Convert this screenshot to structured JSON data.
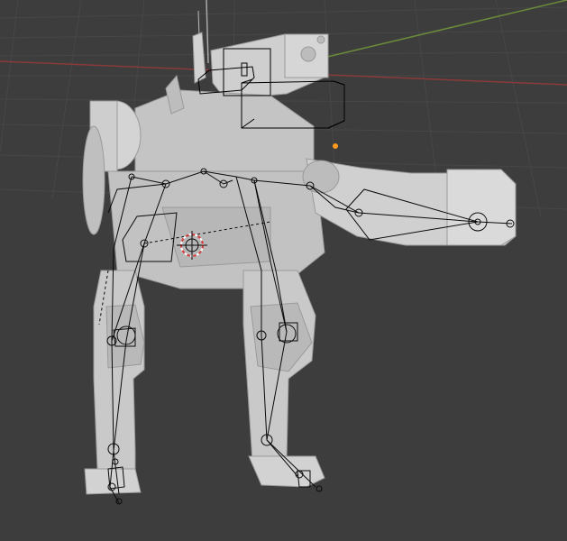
{
  "viewport": {
    "background": "#3d3d3d",
    "grid_color": "#454545",
    "x_axis_color": "#8a3a3a",
    "y_axis_color": "#6a8a3a",
    "origin_marker_color": "#ff9a1a",
    "cursor_color": "#d63a3a"
  },
  "model": {
    "mesh_color": "#c9c9c9",
    "mesh_shade_color": "#a6a6a6",
    "mesh_dark_color": "#8c8c8c",
    "wire_color": "#000000"
  }
}
